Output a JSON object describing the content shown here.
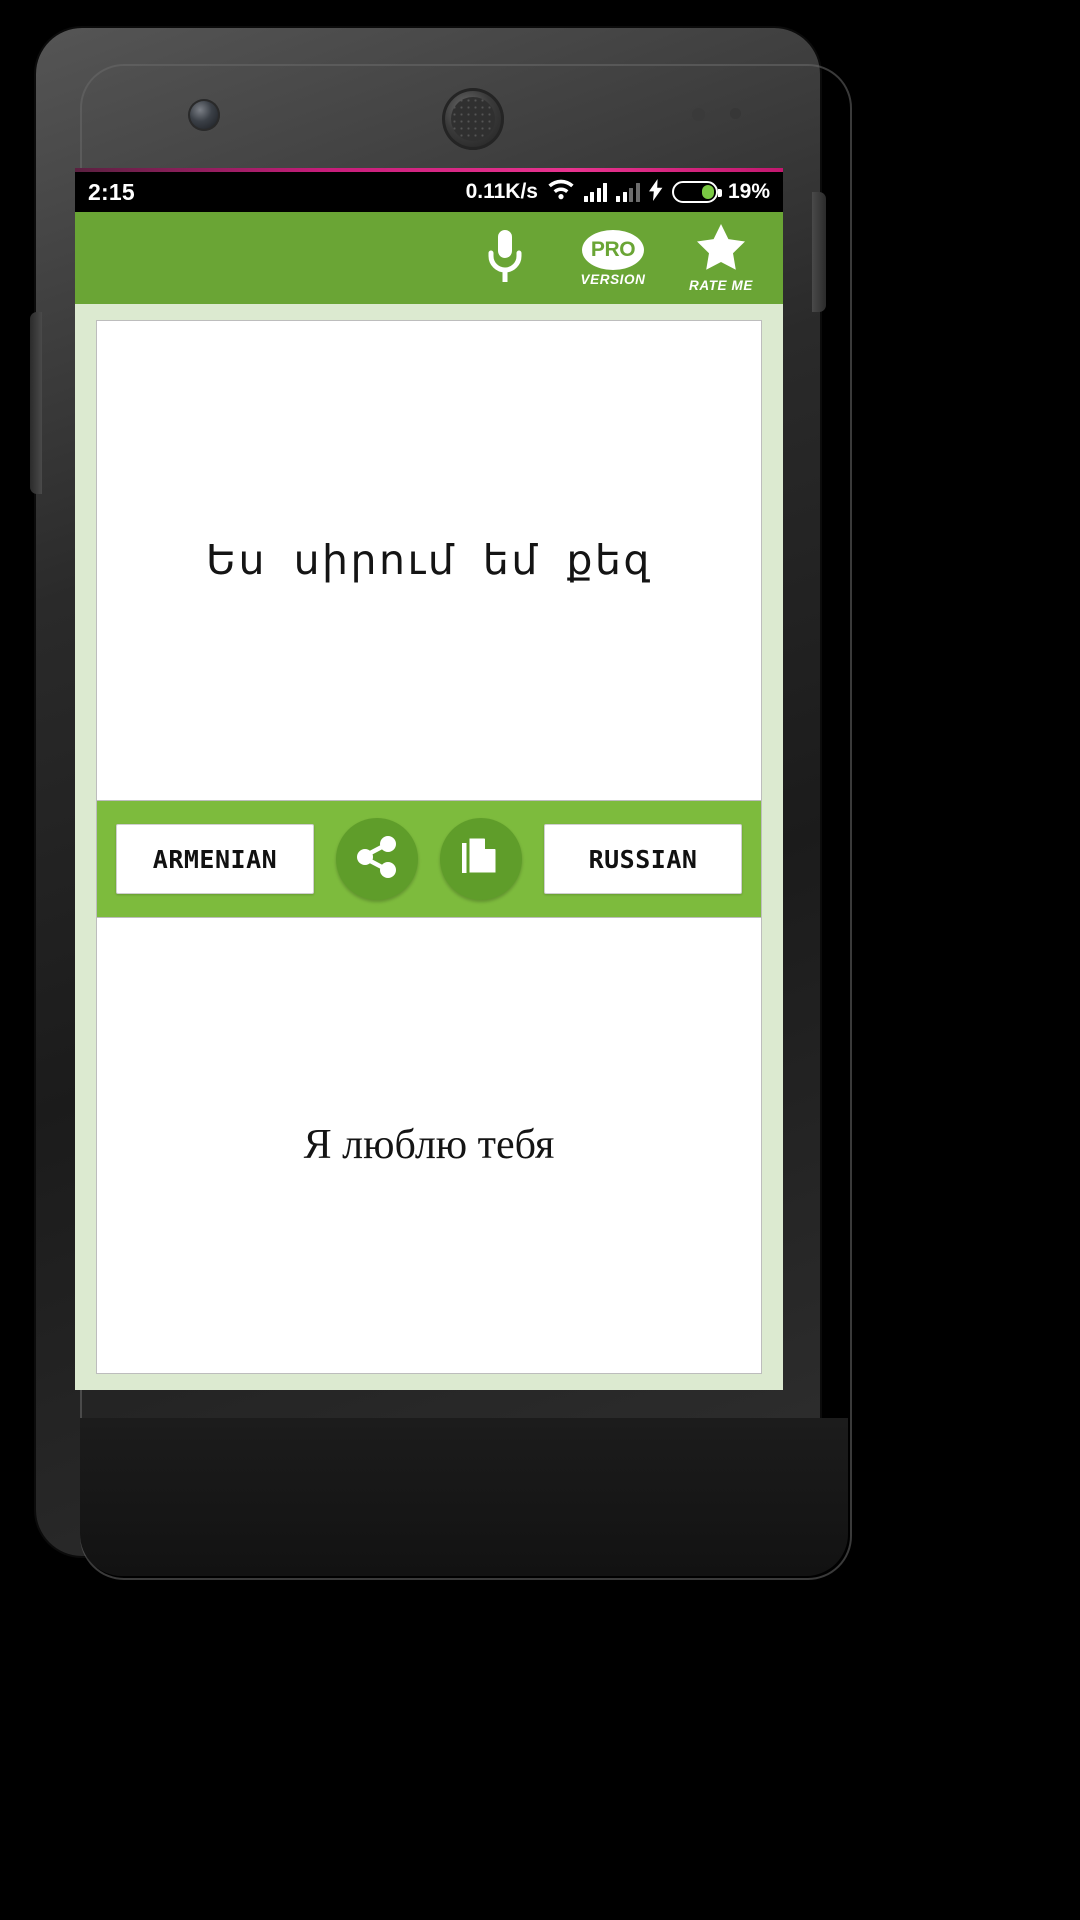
{
  "status_bar": {
    "clock": "2:15",
    "network_speed": "0.11K/s",
    "battery_percent": "19%",
    "icons": [
      "wifi-icon",
      "signal-icon",
      "signal-icon",
      "charging-bolt-icon",
      "battery-icon"
    ]
  },
  "app_bar": {
    "mic_label": "",
    "pro_text": "PRO",
    "pro_label": "VERSION",
    "rate_label": "RATE ME"
  },
  "translator": {
    "source_text": "Ես սիրում եմ քեզ",
    "target_text": "Я люблю тебя",
    "source_language": "ARMENIAN",
    "target_language": "RUSSIAN",
    "share_icon": "share-icon",
    "copy_icon": "copy-icon"
  },
  "colors": {
    "appbar_green": "#6aa535",
    "action_green": "#7dbb3d",
    "circle_green": "#5f9d2a",
    "body_green": "#dcead0",
    "battery_green": "#7ac943"
  }
}
